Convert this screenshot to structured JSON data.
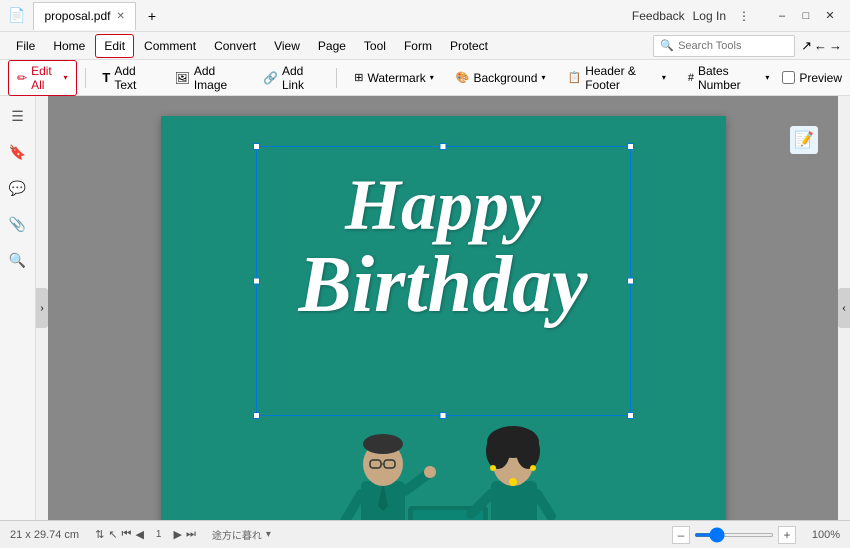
{
  "titleBar": {
    "appIcon": "📄",
    "tabs": [
      {
        "label": "proposal.pdf",
        "closable": true
      }
    ],
    "addTabLabel": "+",
    "rightItems": [
      "Feedback",
      "Log In"
    ],
    "windowControls": [
      "–",
      "□",
      "✕"
    ]
  },
  "menuBar": {
    "items": [
      {
        "id": "file",
        "label": "File"
      },
      {
        "id": "home",
        "label": "Home"
      },
      {
        "id": "edit",
        "label": "Edit",
        "active": true
      },
      {
        "id": "comment",
        "label": "Comment"
      },
      {
        "id": "convert",
        "label": "Convert"
      },
      {
        "id": "view",
        "label": "View"
      },
      {
        "id": "page",
        "label": "Page"
      },
      {
        "id": "tool",
        "label": "Tool"
      },
      {
        "id": "form",
        "label": "Form"
      },
      {
        "id": "protect",
        "label": "Protect"
      }
    ],
    "search": {
      "placeholder": "Search Tools"
    }
  },
  "toolbar": {
    "editAll": {
      "label": "Edit All",
      "icon": "✏"
    },
    "addText": {
      "label": "Add Text",
      "icon": "T"
    },
    "addImage": {
      "label": "Add Image",
      "icon": "🖼"
    },
    "addLink": {
      "label": "Add Link",
      "icon": "🔗"
    },
    "watermark": {
      "label": "Watermark",
      "hasArrow": true
    },
    "background": {
      "label": "Background",
      "hasArrow": true
    },
    "headerFooter": {
      "label": "Header & Footer",
      "hasArrow": true
    },
    "batesNumber": {
      "label": "Bates Number",
      "hasArrow": true
    },
    "preview": {
      "label": "Preview"
    }
  },
  "sidebar": {
    "icons": [
      {
        "id": "hand",
        "symbol": "☰"
      },
      {
        "id": "bookmark",
        "symbol": "🔖"
      },
      {
        "id": "comment",
        "symbol": "💬"
      },
      {
        "id": "attachment",
        "symbol": "📎"
      },
      {
        "id": "search",
        "symbol": "🔍"
      }
    ]
  },
  "document": {
    "title": "Happy Birthday",
    "line1": "Happy",
    "line2": "Birthday",
    "bgColor": "#1a8c7a",
    "size": "21 x 29.74 cm"
  },
  "bottomBar": {
    "size": "21 x 29.74 cm",
    "navFirst": "⏮",
    "navPrev": "◀",
    "pageNum": "1",
    "navNext": "▶",
    "navLast": "⏭",
    "zoomOut": "–",
    "zoomIn": "+",
    "zoomLevel": "100%"
  },
  "colors": {
    "activeMenuBorder": "#d0021b",
    "handleColor": "#0078d4",
    "topHandleColor": "#4CAF50",
    "tealBg": "#1a8c7a"
  }
}
